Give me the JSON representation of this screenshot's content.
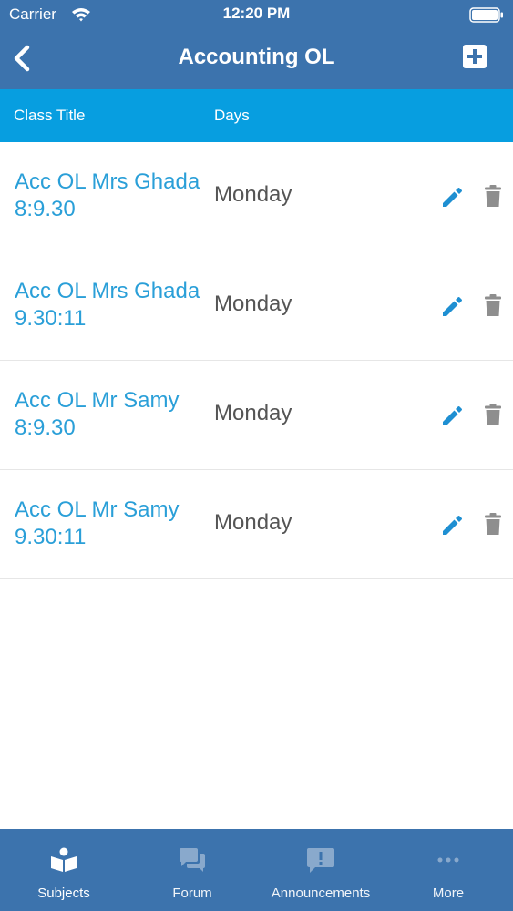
{
  "status_bar": {
    "carrier": "Carrier",
    "time": "12:20 PM"
  },
  "nav": {
    "title": "Accounting OL",
    "back_icon": "chevron-left-icon",
    "add_icon": "plus-square-icon"
  },
  "table_header": {
    "class_title": "Class Title",
    "days": "Days"
  },
  "classes": [
    {
      "title": "Acc OL Mrs Ghada\n8:9.30",
      "days": "Monday"
    },
    {
      "title": "Acc OL Mrs Ghada\n9.30:11",
      "days": "Monday"
    },
    {
      "title": "Acc OL Mr Samy\n8:9.30",
      "days": "Monday"
    },
    {
      "title": "Acc OL Mr Samy\n9.30:11",
      "days": "Monday"
    }
  ],
  "tabs": [
    {
      "label": "Subjects",
      "icon": "book-reader-icon",
      "active": true
    },
    {
      "label": "Forum",
      "icon": "chat-bubbles-icon",
      "active": false
    },
    {
      "label": "Announcements",
      "icon": "announcement-icon",
      "active": false
    },
    {
      "label": "More",
      "icon": "more-dots-icon",
      "active": false
    }
  ],
  "colors": {
    "nav_background": "#3c73ad",
    "header_background": "#079ee0",
    "title_text": "#2a9fd8",
    "edit_icon": "#1e8fd2",
    "delete_icon": "#8e8e8e"
  }
}
